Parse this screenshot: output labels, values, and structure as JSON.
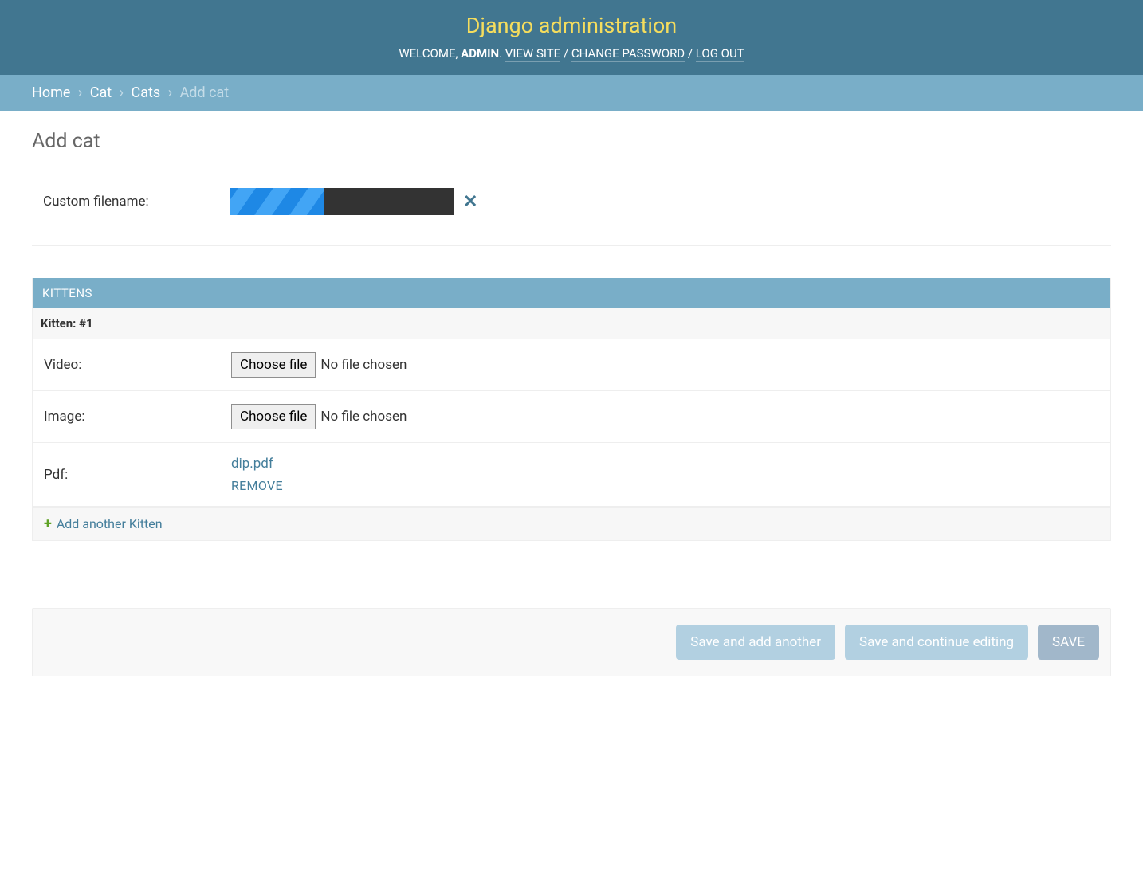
{
  "header": {
    "title": "Django administration",
    "welcome_prefix": "WELCOME, ",
    "username": "ADMIN",
    "period": ". ",
    "view_site": "VIEW SITE",
    "change_password": "CHANGE PASSWORD",
    "log_out": "LOG OUT",
    "sep": " / "
  },
  "breadcrumbs": {
    "home": "Home",
    "app": "Cat",
    "model": "Cats",
    "current": "Add cat",
    "sep": "›"
  },
  "page_title": "Add cat",
  "form": {
    "custom_filename_label": "Custom filename:",
    "progress_percent": 42,
    "close_symbol": "✕"
  },
  "inline": {
    "heading": "KITTENS",
    "item_title": "Kitten: #1",
    "rows": {
      "video_label": "Video:",
      "video_button": "Choose file",
      "video_status": "No file chosen",
      "image_label": "Image:",
      "image_button": "Choose file",
      "image_status": "No file chosen",
      "pdf_label": "Pdf:",
      "pdf_filename": "dip.pdf",
      "pdf_remove": "REMOVE"
    },
    "add_another": "Add another Kitten",
    "plus_symbol": "+"
  },
  "submit": {
    "add_another": "Save and add another",
    "continue": "Save and continue editing",
    "save": "SAVE"
  }
}
